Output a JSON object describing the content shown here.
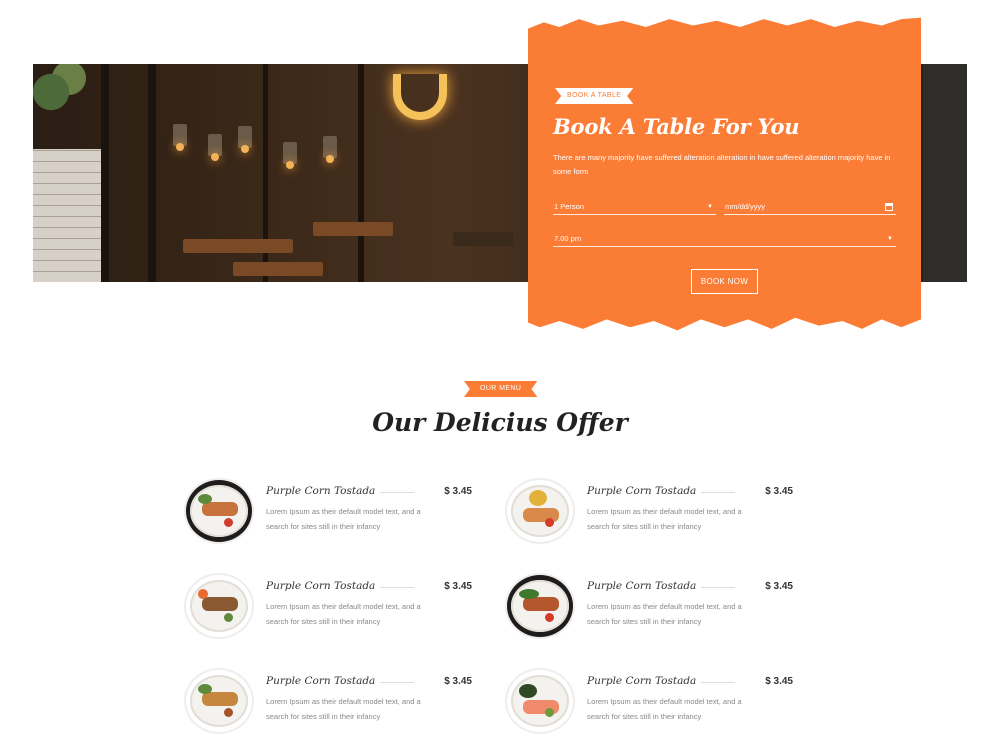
{
  "booking": {
    "tag": "Book A Table",
    "title": "Book A Table For You",
    "description": "There are many majority have suffered alteration alteration in have suffered alteration majority have in some form",
    "person_value": "1 Person",
    "date_placeholder": "mm/dd/yyyy",
    "time_value": "7.00 pm",
    "button_label": "Book Now"
  },
  "menu": {
    "tag": "Our Menu",
    "title": "Our Delicius Offer",
    "items": [
      {
        "name": "Purple Corn Tostada",
        "price": "$ 3.45",
        "text": "Lorem Ipsum as their default model text, and a search for sites still in their infancy"
      },
      {
        "name": "Purple Corn Tostada",
        "price": "$ 3.45",
        "text": "Lorem Ipsum as their default model text, and a search for sites still in their infancy"
      },
      {
        "name": "Purple Corn Tostada",
        "price": "$ 3.45",
        "text": "Lorem Ipsum as their default model text, and a search for sites still in their infancy"
      },
      {
        "name": "Purple Corn Tostada",
        "price": "$ 3.45",
        "text": "Lorem Ipsum as their default model text, and a search for sites still in their infancy"
      },
      {
        "name": "Purple Corn Tostada",
        "price": "$ 3.45",
        "text": "Lorem Ipsum as their default model text, and a search for sites still in their infancy"
      },
      {
        "name": "Purple Corn Tostada",
        "price": "$ 3.45",
        "text": "Lorem Ipsum as their default model text, and a search for sites still in their infancy"
      }
    ]
  },
  "colors": {
    "accent": "#fb7c35",
    "heading": "#222222",
    "body_text": "#888888"
  }
}
